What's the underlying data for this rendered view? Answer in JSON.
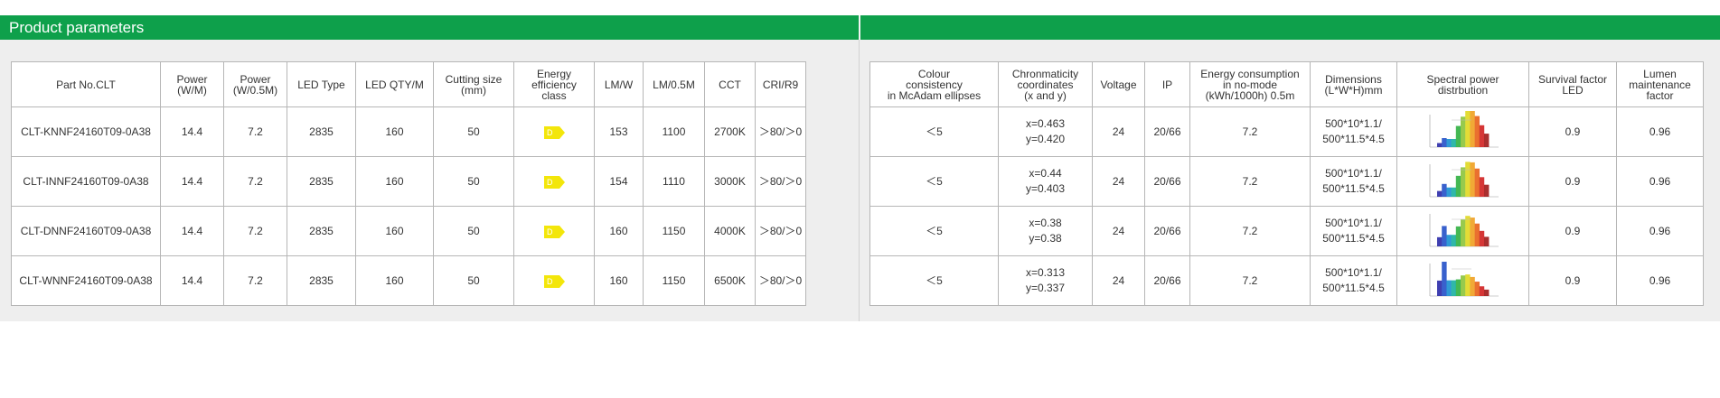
{
  "title": "Product parameters",
  "left_headers": [
    "Part No.CLT",
    "Power\n(W/M)",
    "Power\n(W/0.5M)",
    "LED Type",
    "LED QTY/M",
    "Cutting size\n(mm)",
    "Energy\nefficiency\nclass",
    "LM/W",
    "LM/0.5M",
    "CCT",
    "CRI/R9"
  ],
  "right_headers": [
    "Colour\nconsistency\nin McAdam ellipses",
    "Chronmaticity\ncoordinates\n(x and y)",
    "Voltage",
    "IP",
    "Energy consumption\nin no-mode\n(kWh/1000h) 0.5m",
    "Dimensions\n(L*W*H)mm",
    "Spectral power\ndistrbution",
    "Survival factor\nLED",
    "Lumen\nmaintenance\nfactor"
  ],
  "rows": [
    {
      "part_no": "CLT-KNNF24160T09-0A38",
      "power_wm": "14.4",
      "power_w05m": "7.2",
      "led_type": "2835",
      "led_qty": "160",
      "cutting": "50",
      "energy_class": "D",
      "lmw": "153",
      "lm05m": "1100",
      "cct": "2700K",
      "cri": "＞80/＞0",
      "mcadam": "＜5",
      "chroma_x": "x=0.463",
      "chroma_y": "y=0.420",
      "voltage": "24",
      "ip": "20/66",
      "energy_no_mode": "7.2",
      "dim_line1": "500*10*1.1/",
      "dim_line2": "500*11.5*4.5",
      "survival": "0.9",
      "lumen_maint": "0.96"
    },
    {
      "part_no": "CLT-INNF24160T09-0A38",
      "power_wm": "14.4",
      "power_w05m": "7.2",
      "led_type": "2835",
      "led_qty": "160",
      "cutting": "50",
      "energy_class": "D",
      "lmw": "154",
      "lm05m": "1110",
      "cct": "3000K",
      "cri": "＞80/＞0",
      "mcadam": "＜5",
      "chroma_x": "x=0.44",
      "chroma_y": "y=0.403",
      "voltage": "24",
      "ip": "20/66",
      "energy_no_mode": "7.2",
      "dim_line1": "500*10*1.1/",
      "dim_line2": "500*11.5*4.5",
      "survival": "0.9",
      "lumen_maint": "0.96"
    },
    {
      "part_no": "CLT-DNNF24160T09-0A38",
      "power_wm": "14.4",
      "power_w05m": "7.2",
      "led_type": "2835",
      "led_qty": "160",
      "cutting": "50",
      "energy_class": "D",
      "lmw": "160",
      "lm05m": "1150",
      "cct": "4000K",
      "cri": "＞80/＞0",
      "mcadam": "＜5",
      "chroma_x": "x=0.38",
      "chroma_y": "y=0.38",
      "voltage": "24",
      "ip": "20/66",
      "energy_no_mode": "7.2",
      "dim_line1": "500*10*1.1/",
      "dim_line2": "500*11.5*4.5",
      "survival": "0.9",
      "lumen_maint": "0.96"
    },
    {
      "part_no": "CLT-WNNF24160T09-0A38",
      "power_wm": "14.4",
      "power_w05m": "7.2",
      "led_type": "2835",
      "led_qty": "160",
      "cutting": "50",
      "energy_class": "D",
      "lmw": "160",
      "lm05m": "1150",
      "cct": "6500K",
      "cri": "＞80/＞0",
      "mcadam": "＜5",
      "chroma_x": "x=0.313",
      "chroma_y": "y=0.337",
      "voltage": "24",
      "ip": "20/66",
      "energy_no_mode": "7.2",
      "dim_line1": "500*10*1.1/",
      "dim_line2": "500*11.5*4.5",
      "survival": "0.9",
      "lumen_maint": "0.96"
    }
  ],
  "colors": {
    "header_green": "#0ea04b",
    "panel_gray": "#eeeeee",
    "energy_badge": "#f3e60a"
  }
}
